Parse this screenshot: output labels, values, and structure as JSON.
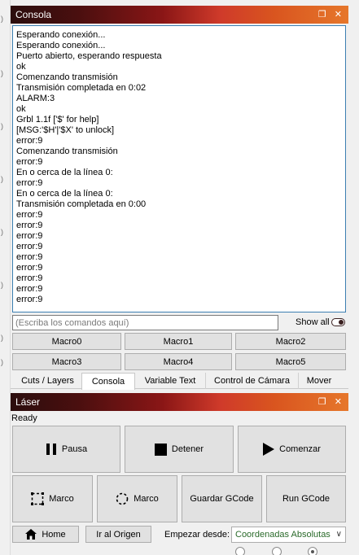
{
  "console_panel": {
    "title": "Consola",
    "lines": [
      "Esperando conexión...",
      "Esperando conexión...",
      "Puerto abierto, esperando respuesta",
      "ok",
      "Comenzando transmisión",
      "Transmisión completada en 0:02",
      "ALARM:3",
      "ok",
      "Grbl 1.1f ['$' for help]",
      "[MSG:'$H'|'$X' to unlock]",
      "error:9",
      "Comenzando transmisión",
      "error:9",
      "En o cerca de la línea 0:",
      "error:9",
      "En o cerca de la línea 0:",
      "Transmisión completada en 0:00",
      "error:9",
      "error:9",
      "error:9",
      "error:9",
      "error:9",
      "error:9",
      "error:9",
      "error:9",
      "error:9"
    ],
    "command_placeholder": "(Escriba los comandos aquí)",
    "show_all_label": "Show all",
    "macros": [
      "Macro0",
      "Macro1",
      "Macro2",
      "Macro3",
      "Macro4",
      "Macro5"
    ]
  },
  "tabs": [
    {
      "label": "Cuts / Layers",
      "active": false
    },
    {
      "label": "Consola",
      "active": true
    },
    {
      "label": "Variable Text",
      "active": false
    },
    {
      "label": "Control de Cámara",
      "active": false
    },
    {
      "label": "Mover",
      "active": false
    }
  ],
  "laser_panel": {
    "title": "Láser",
    "status": "Ready",
    "buttons": {
      "pause": "Pausa",
      "stop": "Detener",
      "start": "Comenzar",
      "frame_rect": "Marco",
      "frame_round": "Marco",
      "save_gcode": "Guardar GCode",
      "run_gcode": "Run GCode",
      "home": "Home",
      "go_origin": "Ir al Origen"
    },
    "start_from_label": "Empezar desde:",
    "start_from_value": "Coordenadas Absolutas"
  },
  "colors": {
    "accent_border": "#3c7fb1",
    "select_text": "#2a6a2a"
  }
}
